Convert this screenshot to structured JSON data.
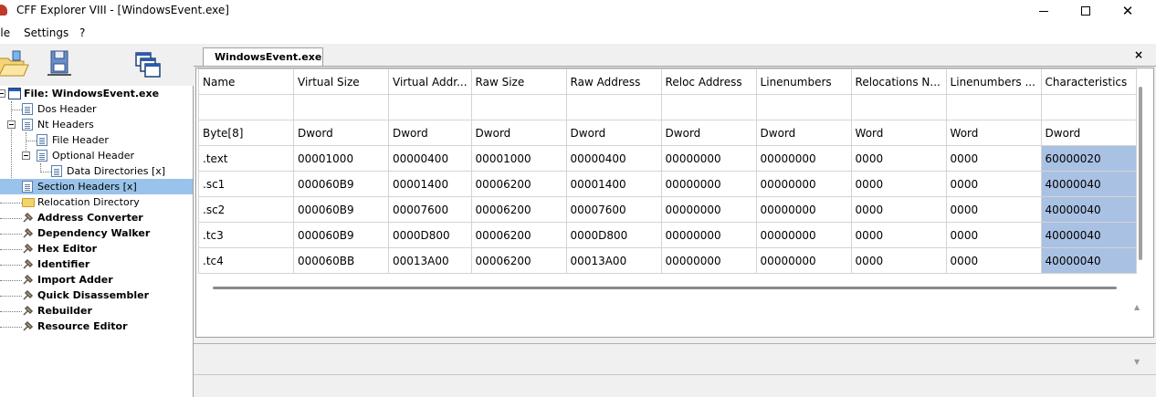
{
  "window": {
    "title": "CFF Explorer VIII - [WindowsEvent.exe]",
    "controls": [
      "minimize",
      "maximize",
      "close"
    ]
  },
  "menu": {
    "items": [
      "File",
      "Settings",
      "?"
    ]
  },
  "toolbar": {
    "buttons": [
      {
        "name": "open-icon"
      },
      {
        "name": "save-icon"
      },
      {
        "name": "windows-icon"
      }
    ]
  },
  "tree": {
    "nodes": [
      {
        "label": "File: WindowsEvent.exe",
        "bold": true,
        "icon": "file-icon",
        "expanded": true,
        "level": 0
      },
      {
        "label": "Dos Header",
        "icon": "doc-icon",
        "level": 1
      },
      {
        "label": "Nt Headers",
        "icon": "doc-icon",
        "expanded": true,
        "level": 1
      },
      {
        "label": "File Header",
        "icon": "doc-icon",
        "level": 2
      },
      {
        "label": "Optional Header",
        "icon": "doc-icon",
        "expanded": true,
        "level": 2
      },
      {
        "label": "Data Directories [x]",
        "icon": "doc-icon",
        "level": 3
      },
      {
        "label": "Section Headers [x]",
        "icon": "doc-icon",
        "level": 1,
        "selected": true
      },
      {
        "label": "Relocation Directory",
        "icon": "folder-icon",
        "level": 1
      },
      {
        "label": "Address Converter",
        "bold": true,
        "icon": "tool-icon",
        "level": 1
      },
      {
        "label": "Dependency Walker",
        "bold": true,
        "icon": "tool-icon",
        "level": 1
      },
      {
        "label": "Hex Editor",
        "bold": true,
        "icon": "tool-icon",
        "level": 1
      },
      {
        "label": "Identifier",
        "bold": true,
        "icon": "tool-icon",
        "level": 1
      },
      {
        "label": "Import Adder",
        "bold": true,
        "icon": "tool-icon",
        "level": 1
      },
      {
        "label": "Quick Disassembler",
        "bold": true,
        "icon": "tool-icon",
        "level": 1
      },
      {
        "label": "Rebuilder",
        "bold": true,
        "icon": "tool-icon",
        "level": 1
      },
      {
        "label": "Resource Editor",
        "bold": true,
        "icon": "tool-icon",
        "level": 1
      }
    ]
  },
  "tab": {
    "label": "WindowsEvent.exe",
    "close": "×"
  },
  "grid": {
    "columns": [
      "Name",
      "Virtual Size",
      "Virtual Addr...",
      "Raw Size",
      "Raw Address",
      "Reloc Address",
      "Linenumbers",
      "Relocations N...",
      "Linenumbers ...",
      "Characteristics"
    ],
    "types": [
      "Byte[8]",
      "Dword",
      "Dword",
      "Dword",
      "Dword",
      "Dword",
      "Dword",
      "Word",
      "Word",
      "Dword"
    ],
    "rows": [
      [
        ".text",
        "00001000",
        "00000400",
        "00001000",
        "00000400",
        "00000000",
        "00000000",
        "0000",
        "0000",
        "60000020"
      ],
      [
        ".sc1",
        "000060B9",
        "00001400",
        "00006200",
        "00001400",
        "00000000",
        "00000000",
        "0000",
        "0000",
        "40000040"
      ],
      [
        ".sc2",
        "000060B9",
        "00007600",
        "00006200",
        "00007600",
        "00000000",
        "00000000",
        "0000",
        "0000",
        "40000040"
      ],
      [
        ".tc3",
        "000060B9",
        "0000D800",
        "00006200",
        "0000D800",
        "00000000",
        "00000000",
        "0000",
        "0000",
        "40000040"
      ],
      [
        ".tc4",
        "000060BB",
        "00013A00",
        "00006200",
        "00013A00",
        "00000000",
        "00000000",
        "0000",
        "0000",
        "40000040"
      ]
    ],
    "highlight_color": "#a9c1e3",
    "selection_color": "#99c3ea"
  }
}
